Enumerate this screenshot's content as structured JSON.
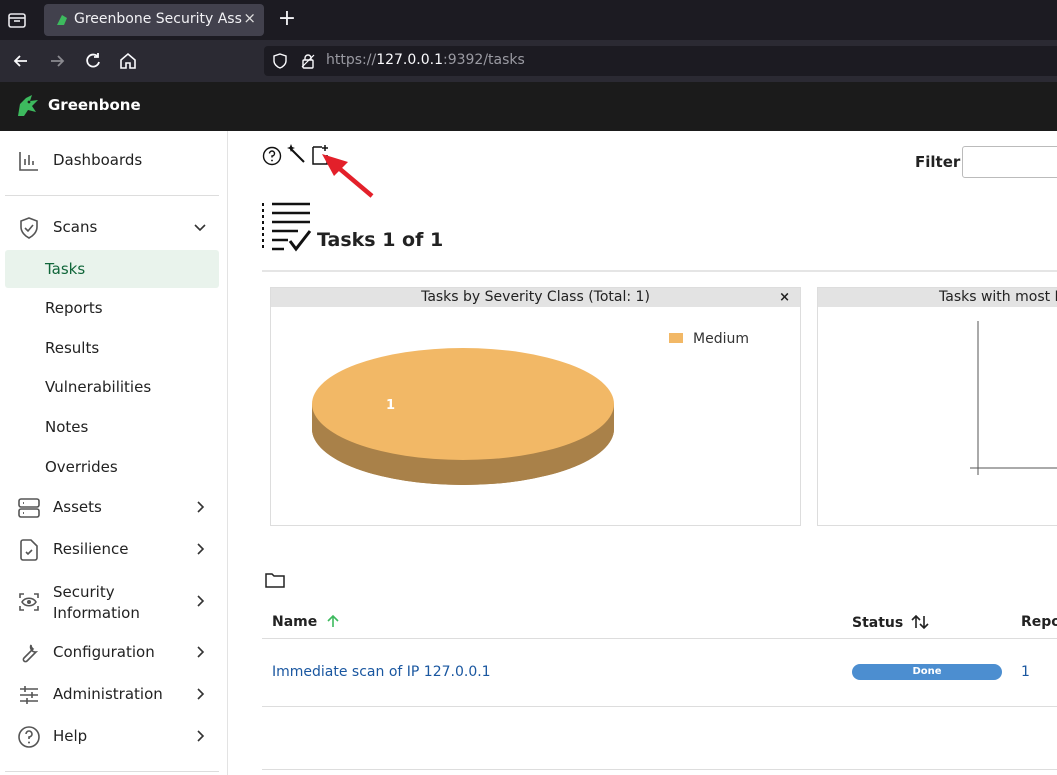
{
  "browser": {
    "tab_title": "Greenbone Security Assistant",
    "tab_close": "×",
    "new_tab": "+",
    "url_prefix": "https://",
    "url_host": "127.0.0.1",
    "url_rest": ":9392/tasks"
  },
  "app": {
    "brand": "Greenbone"
  },
  "sidebar": {
    "dashboards": "Dashboards",
    "scans": "Scans",
    "scans_items": [
      "Tasks",
      "Reports",
      "Results",
      "Vulnerabilities",
      "Notes",
      "Overrides"
    ],
    "assets": "Assets",
    "resilience": "Resilience",
    "security_info_line1": "Security",
    "security_info_line2": "Information",
    "configuration": "Configuration",
    "administration": "Administration",
    "help": "Help"
  },
  "toolbar": {
    "filter_label": "Filter"
  },
  "page": {
    "title": "Tasks 1 of 1"
  },
  "charts": {
    "severity_title": "Tasks by Severity Class (Total: 1)",
    "severity_close": "×",
    "most_title": "Tasks with most High Results per Host"
  },
  "chart_data": {
    "type": "pie",
    "title": "Tasks by Severity Class (Total: 1)",
    "slices": [
      {
        "label": "Medium",
        "value": 1,
        "color": "#f2b866"
      }
    ],
    "legend": "top-right"
  },
  "table": {
    "headers": {
      "name": "Name",
      "status": "Status",
      "reports": "Reports"
    },
    "rows": [
      {
        "name": "Immediate scan of IP 127.0.0.1",
        "status": "Done",
        "reports": "1"
      }
    ]
  },
  "colors": {
    "accent": "#11663a",
    "status_done": "#4c8ed0",
    "link": "#1a57a0"
  }
}
